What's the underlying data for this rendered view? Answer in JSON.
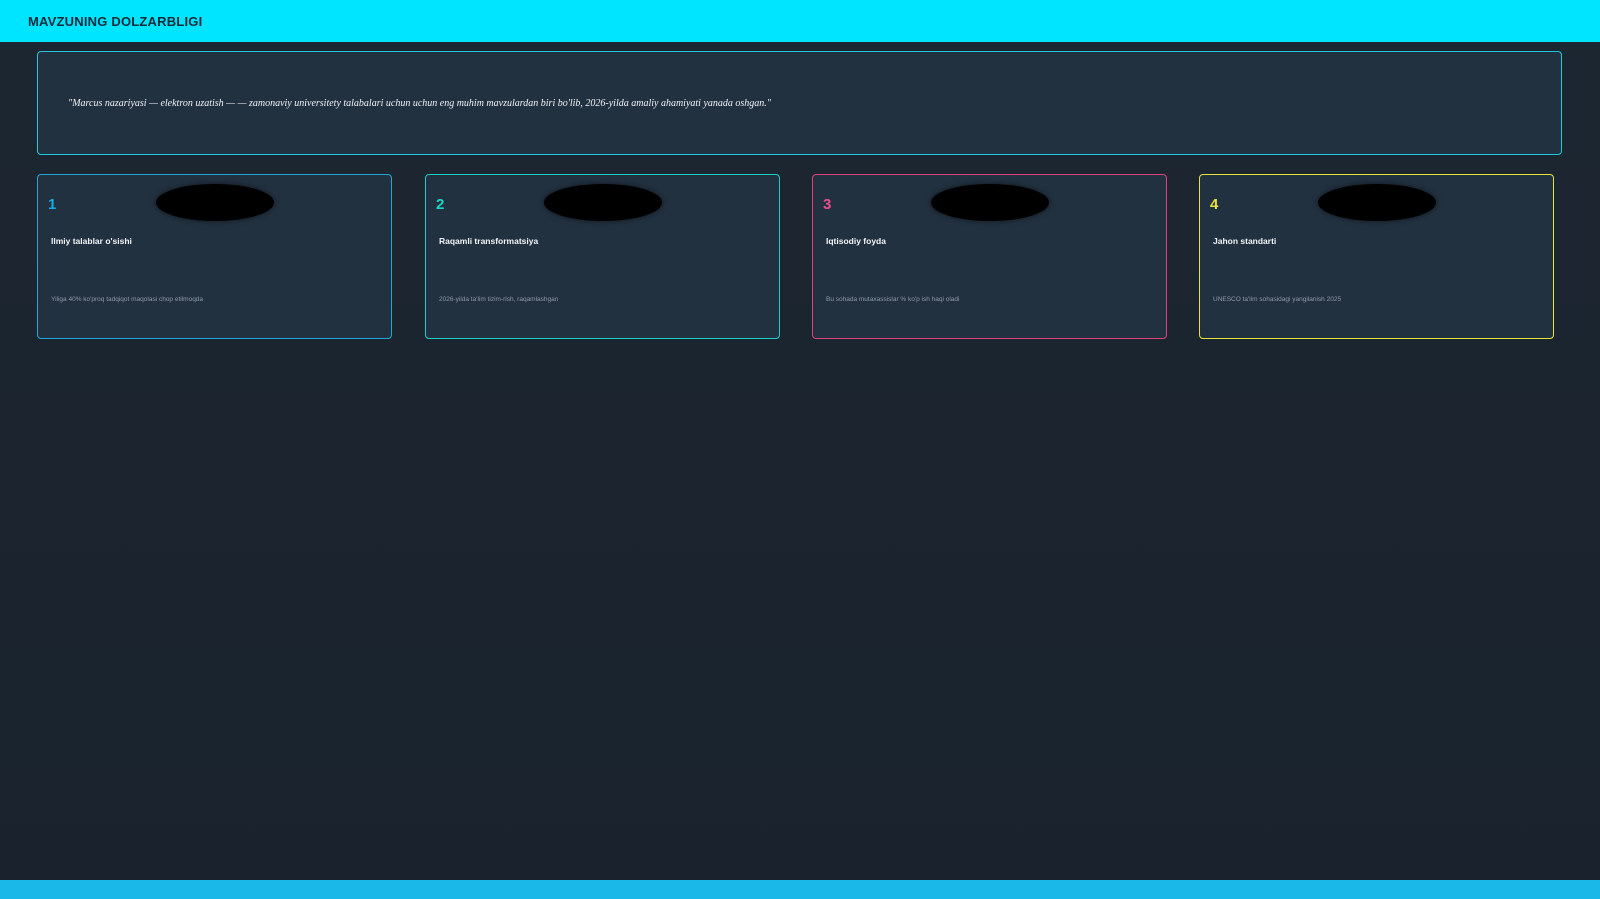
{
  "header": {
    "title": "MAVZUNING DOLZARBLIGI"
  },
  "quote": {
    "text": "\"Marcus nazariyasi — elektron uzatish — — zamonaviy universitety talabalari uchun uchun eng muhim mavzulardan biri bo'lib, 2026-yilda amaliy ahamiyati yanada oshgan.\""
  },
  "cards": [
    {
      "number": "1",
      "title": "Ilmiy talablar o'sishi",
      "desc": "Yiliga 40% ko'proq tadqiqot maqolasi chop etilmoqda",
      "accent": "#1aa9e6"
    },
    {
      "number": "2",
      "title": "Raqamli transformatsiya",
      "desc": "2026-yilda ta'lim tizim-rlsh, raqamlashgan",
      "accent": "#1bd6c6"
    },
    {
      "number": "3",
      "title": "Iqtisodiy foyda",
      "desc": "Bu sohada mutaxassislar % ko'p ish haqi oladi",
      "accent": "#ec4e8a"
    },
    {
      "number": "4",
      "title": "Jahon standarti",
      "desc": "UNESCO ta'lim sohasidagi yangilanish 2025",
      "accent": "#eae13c"
    }
  ]
}
